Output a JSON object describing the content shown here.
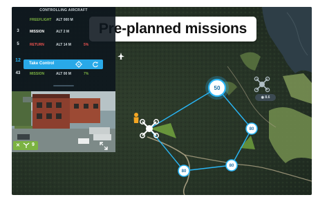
{
  "banner": {
    "title": "Pre-planned missions"
  },
  "panel": {
    "header": "CONTROLLING AIRCRAFT",
    "rows": [
      {
        "num": "",
        "name": "FREEFLIGHT",
        "alt": "ALT 000 M",
        "extra": "",
        "name_color": "#7cb342"
      },
      {
        "num": "3",
        "name": "MISSION",
        "alt": "ALT 2 M",
        "extra": "",
        "name_color": "#ffffff"
      },
      {
        "num": "5",
        "name": "RETURN",
        "alt": "ALT 14 M",
        "extra": "5%",
        "name_color": "#ef5350"
      },
      {
        "num": "43",
        "name": "MISSION",
        "alt": "ALT 00 M",
        "extra": "7%",
        "name_color": "#7cb342"
      }
    ],
    "take_control": {
      "num": "12",
      "label": "Take Control"
    }
  },
  "camera": {
    "badge_x": "✕",
    "badge_count": "9"
  },
  "map": {
    "waypoints": [
      {
        "label": "50",
        "size": "large"
      },
      {
        "label": "80",
        "size": "small"
      },
      {
        "label": "80",
        "size": "small"
      },
      {
        "label": "80",
        "size": "small"
      }
    ],
    "remote_drone_alt": "◉ 8.6"
  },
  "colors": {
    "path": "#29b6f6",
    "accent_green": "#7cb342",
    "panel_bg": "#0c161e",
    "take_control_bg": "#29a9e8"
  },
  "icons": [
    "target-icon",
    "refresh-icon",
    "expand-icon",
    "person-marker-icon",
    "drone-icon",
    "plane-icon"
  ]
}
